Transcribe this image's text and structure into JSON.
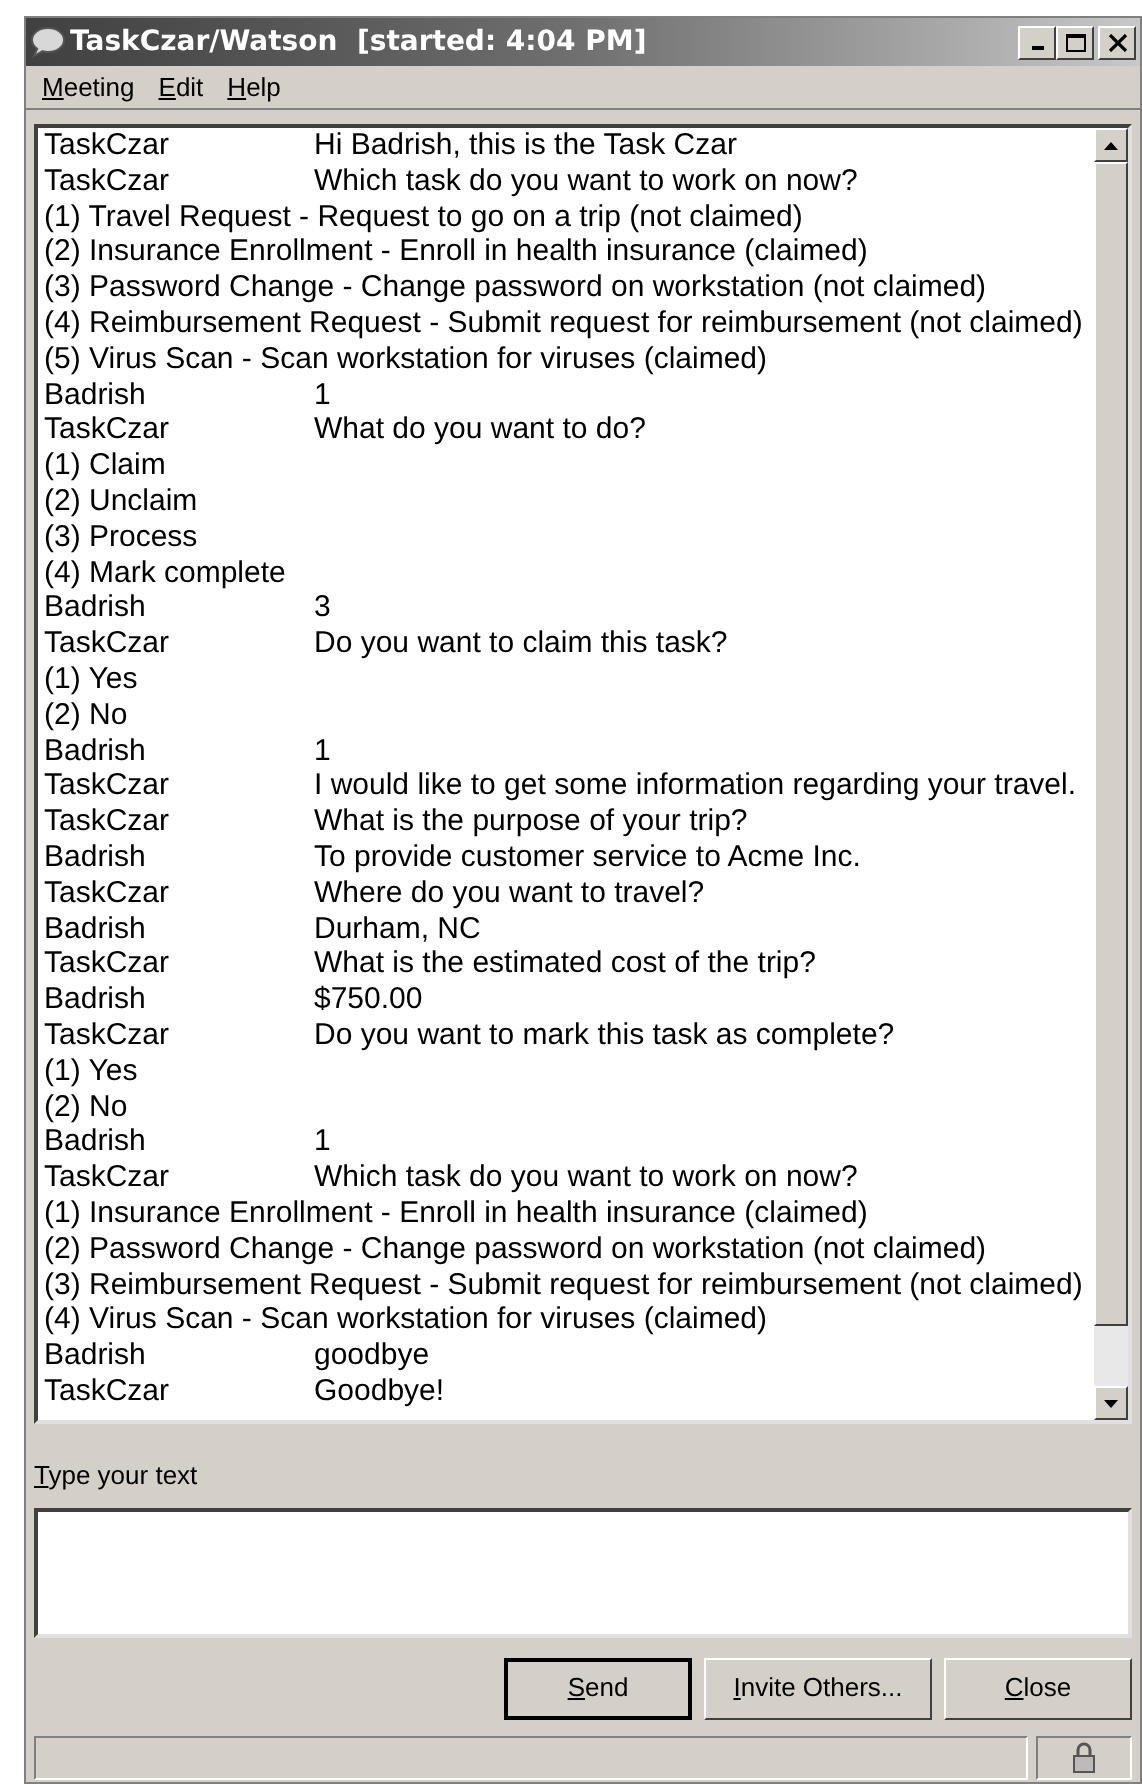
{
  "window": {
    "title": "TaskCzar/Watson  [started: 4:04 PM]"
  },
  "menu": [
    "Meeting",
    "Edit",
    "Help"
  ],
  "transcript": [
    {
      "kind": "message",
      "speaker": "TaskCzar",
      "text": "Hi Badrish, this is the Task Czar"
    },
    {
      "kind": "message",
      "speaker": "TaskCzar",
      "text": "Which task do you want to work on now?"
    },
    {
      "kind": "option",
      "text": "(1) Travel Request - Request to go on a trip (not claimed)"
    },
    {
      "kind": "option",
      "text": "(2) Insurance Enrollment - Enroll in health insurance (claimed)"
    },
    {
      "kind": "option",
      "text": "(3) Password Change - Change password on workstation (not claimed)"
    },
    {
      "kind": "option",
      "text": "(4) Reimbursement Request - Submit request for reimbursement (not claimed)"
    },
    {
      "kind": "option",
      "text": "(5) Virus Scan - Scan workstation for viruses (claimed)"
    },
    {
      "kind": "message",
      "speaker": "Badrish",
      "text": "1"
    },
    {
      "kind": "message",
      "speaker": "TaskCzar",
      "text": "What do you want to do?"
    },
    {
      "kind": "option",
      "text": "(1) Claim"
    },
    {
      "kind": "option",
      "text": "(2) Unclaim"
    },
    {
      "kind": "option",
      "text": "(3) Process"
    },
    {
      "kind": "option",
      "text": "(4) Mark complete"
    },
    {
      "kind": "message",
      "speaker": "Badrish",
      "text": "3"
    },
    {
      "kind": "message",
      "speaker": "TaskCzar",
      "text": "Do you want to claim this task?"
    },
    {
      "kind": "option",
      "text": "(1) Yes"
    },
    {
      "kind": "option",
      "text": "(2) No"
    },
    {
      "kind": "message",
      "speaker": "Badrish",
      "text": "1"
    },
    {
      "kind": "message",
      "speaker": "TaskCzar",
      "text": "I would like to get some information regarding your travel."
    },
    {
      "kind": "message",
      "speaker": "TaskCzar",
      "text": "What is the purpose of your trip?"
    },
    {
      "kind": "message",
      "speaker": "Badrish",
      "text": "To provide customer service to Acme Inc."
    },
    {
      "kind": "message",
      "speaker": "TaskCzar",
      "text": "Where do you want to travel?"
    },
    {
      "kind": "message",
      "speaker": "Badrish",
      "text": "Durham, NC"
    },
    {
      "kind": "message",
      "speaker": "TaskCzar",
      "text": "What is the estimated cost of the trip?"
    },
    {
      "kind": "message",
      "speaker": "Badrish",
      "text": "$750.00"
    },
    {
      "kind": "message",
      "speaker": "TaskCzar",
      "text": "Do you want to mark this task as complete?"
    },
    {
      "kind": "option",
      "text": "(1) Yes"
    },
    {
      "kind": "option",
      "text": "(2) No"
    },
    {
      "kind": "message",
      "speaker": "Badrish",
      "text": "1"
    },
    {
      "kind": "message",
      "speaker": "TaskCzar",
      "text": "Which task do you want to work on now?"
    },
    {
      "kind": "option",
      "text": "(1) Insurance Enrollment - Enroll in health insurance (claimed)"
    },
    {
      "kind": "option",
      "text": "(2) Password Change - Change password on workstation (not claimed)"
    },
    {
      "kind": "option",
      "text": "(3) Reimbursement Request - Submit request for reimbursement (not claimed)"
    },
    {
      "kind": "option",
      "text": "(4) Virus Scan - Scan workstation for viruses (claimed)"
    },
    {
      "kind": "message",
      "speaker": "Badrish",
      "text": "goodbye"
    },
    {
      "kind": "message",
      "speaker": "TaskCzar",
      "text": "Goodbye!"
    }
  ],
  "input": {
    "label": "Type your text"
  },
  "buttons": [
    {
      "label": "Send",
      "default": true
    },
    {
      "label": "Invite Others...",
      "default": false
    },
    {
      "label": "Close",
      "default": false
    }
  ]
}
